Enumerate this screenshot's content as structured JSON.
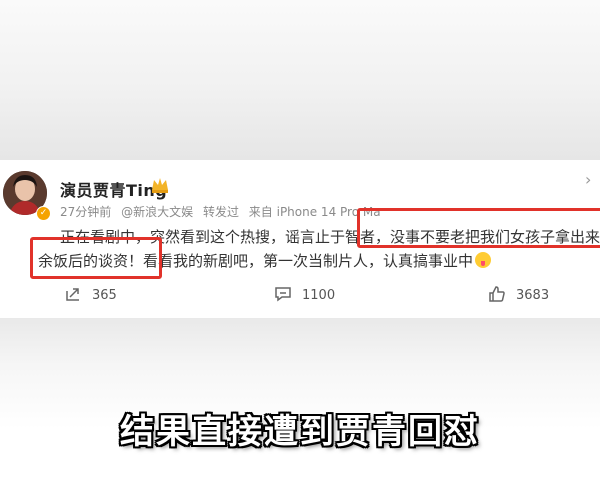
{
  "post": {
    "username": "演员贾青Ting",
    "meta": {
      "time": "27分钟前",
      "forward_from": "@新浪大文娱",
      "forward_label": "转发过",
      "source": "来自 iPhone 14 Pro Ma"
    },
    "text": {
      "line1_pre": "正在看剧中，突然看到这个热搜，谣言止于智者，",
      "line1_hl": "没事不要老把我们女孩子拿出来当茶",
      "line2_hl": "余饭后的谈资！",
      "line2_post": "看看我的新剧吧，第一次当制片人，认真搞事业中"
    },
    "actions": {
      "share_count": "365",
      "comment_count": "1100",
      "like_count": "3683"
    }
  },
  "caption": "结果直接遭到贾青回怼",
  "colors": {
    "highlight_border": "#e1322a",
    "verified_badge": "#f5a300"
  }
}
